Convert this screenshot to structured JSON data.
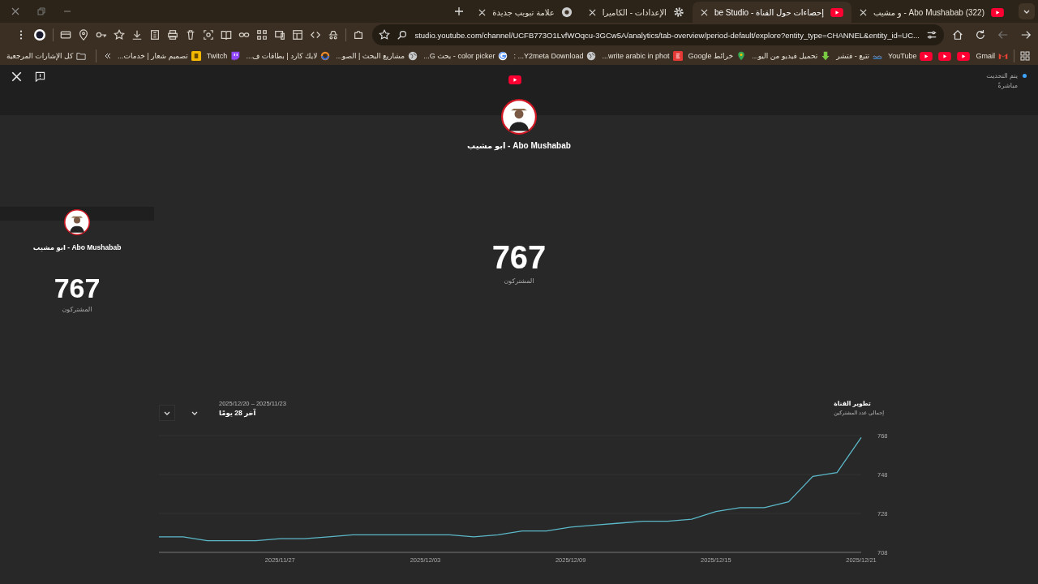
{
  "browser": {
    "tabs": [
      {
        "title": "(322) Abo Mushabab - و مشيب",
        "selected": false,
        "kind": "youtube"
      },
      {
        "title": "إحصاءات حول القناة - be Studio",
        "selected": true,
        "kind": "youtube"
      },
      {
        "title": "الإعدادات - الكاميرا",
        "selected": false,
        "kind": "settings"
      },
      {
        "title": "علامة تبويب جديدة",
        "selected": false,
        "kind": "chrome"
      }
    ],
    "address": "studio.youtube.com/channel/UCFB773O1LvfWOqcu-3GCw5A/analytics/tab-overview/period-default/explore?entity_type=CHANNEL&entity_id=UC...",
    "bookmarks": [
      {
        "label": "Gmail",
        "kind": "gmail"
      },
      {
        "kind": "youtube"
      },
      {
        "kind": "youtube"
      },
      {
        "label": "YouTube",
        "kind": "youtube"
      },
      {
        "label": "تتبع - فتشر",
        "kind": "wave"
      },
      {
        "label": "تحميل فيديو من اليو...",
        "kind": "download"
      },
      {
        "label": "خرائط Google",
        "kind": "maps"
      },
      {
        "label": "write arabic in phot...",
        "kind": "letter"
      },
      {
        "label": "Y2meta Download... :",
        "kind": "globe"
      },
      {
        "label": "color picker - بحث G...",
        "kind": "google"
      },
      {
        "label": "مشاريع البحث | الصو...",
        "kind": "globe"
      },
      {
        "label": "لايك كارد | بطاقات ف...",
        "kind": "ring"
      },
      {
        "label": "Twitch",
        "kind": "twitch"
      },
      {
        "label": "تصميم شعار | خدمات...",
        "kind": "five"
      }
    ],
    "all_bookmarks": "كل الإشارات المرجعية"
  },
  "page": {
    "live": {
      "line_1": "يتم التحديث",
      "line_2": "مباشرةً"
    },
    "sidebar_card": {
      "channel": "Abo Mushabab - ابو مشيب",
      "count": "767",
      "label": "المشتركون"
    },
    "main": {
      "channel": "Abo Mushabab - ابو مشيب",
      "count": "767",
      "label": "المشتركون"
    },
    "chart": {
      "title": "تطوير القناة",
      "subtitle": "إجمالي عدد المشتركين",
      "range": "2025/11/23 – 2025/12/20",
      "period": "آخر 28 يومًا",
      "chart_data": {
        "type": "line",
        "categories": [
          null,
          null,
          null,
          null,
          null,
          "2025/11/27",
          null,
          null,
          null,
          null,
          null,
          "2025/12/03",
          null,
          null,
          null,
          null,
          null,
          "2025/12/09",
          null,
          null,
          null,
          null,
          null,
          "2025/12/15",
          null,
          null,
          null,
          null,
          null,
          "2025/12/21"
        ],
        "ylim": [
          708,
          768
        ],
        "yticks": [
          708,
          728,
          748,
          768
        ],
        "series": [
          {
            "color": "#5bb8c9",
            "values": [
              716,
              716,
              714,
              714,
              714,
              715,
              715,
              716,
              717,
              717,
              717,
              717,
              717,
              716,
              717,
              719,
              719,
              721,
              722,
              723,
              724,
              724,
              725,
              729,
              731,
              731,
              734,
              747,
              749,
              767
            ]
          }
        ]
      }
    }
  }
}
